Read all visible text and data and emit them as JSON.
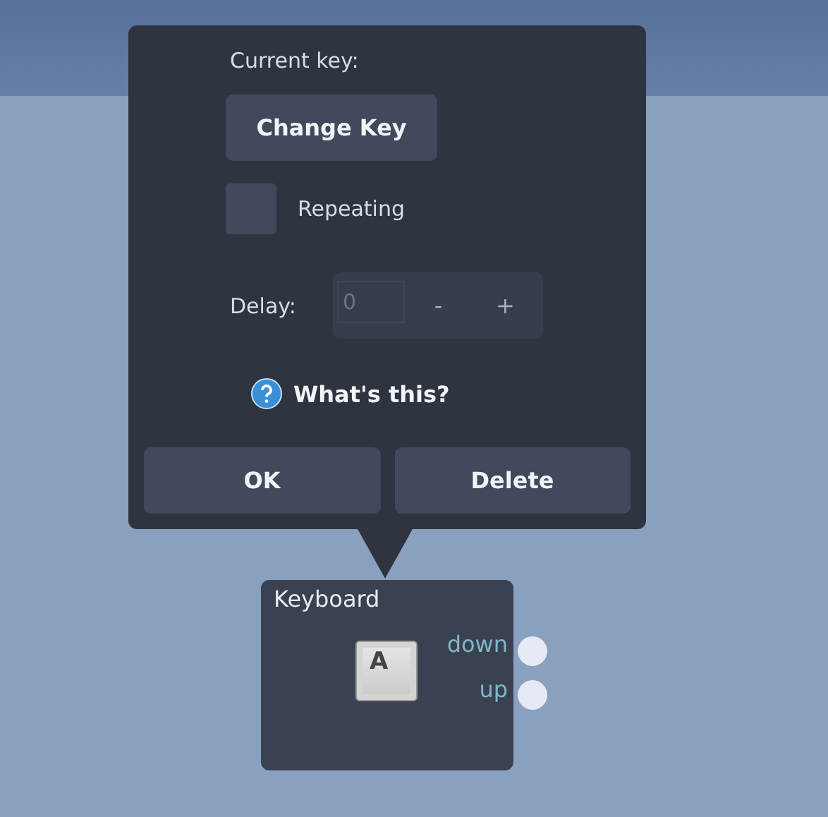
{
  "popup": {
    "current_key_label": "Current key:",
    "change_key_button": "Change Key",
    "repeating": {
      "label": "Repeating",
      "checked": false
    },
    "delay": {
      "label": "Delay:",
      "value": "0",
      "decrement": "-",
      "increment": "+"
    },
    "help_link": "What's this?",
    "buttons": [
      "OK",
      "Delete"
    ]
  },
  "node": {
    "title": "Keyboard",
    "key": "A",
    "ports": [
      {
        "label": "down"
      },
      {
        "label": "up"
      }
    ]
  }
}
